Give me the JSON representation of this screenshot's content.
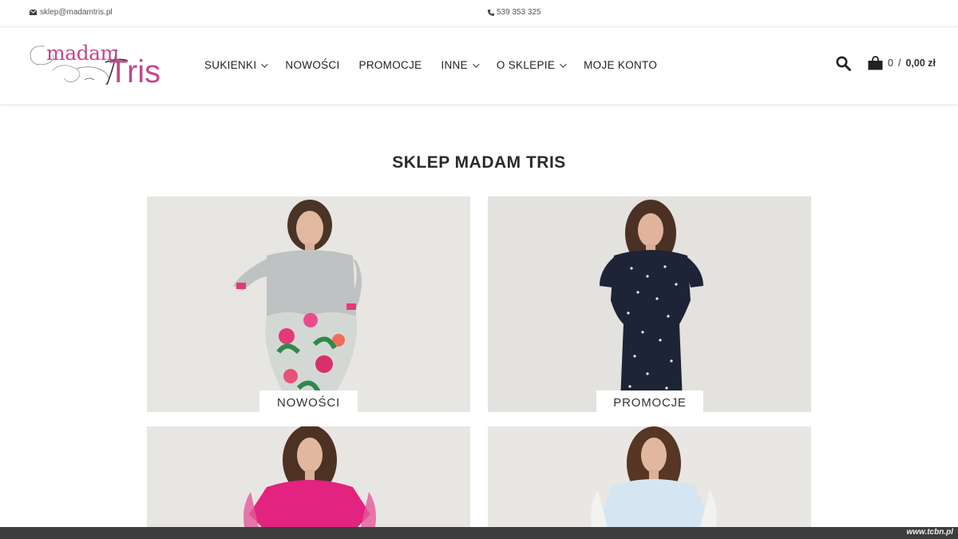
{
  "topbar": {
    "email": "sklep@madamtris.pl",
    "phone": "539 353 325"
  },
  "logo": {
    "word1": "madam",
    "word2": "Tris"
  },
  "nav": [
    {
      "label": "SUKIENKI",
      "dropdown": true
    },
    {
      "label": "NOWOŚCI",
      "dropdown": false
    },
    {
      "label": "PROMOCJE",
      "dropdown": false
    },
    {
      "label": "INNE",
      "dropdown": true
    },
    {
      "label": "O SKLEPIE",
      "dropdown": true
    },
    {
      "label": "MOJE KONTO",
      "dropdown": false
    }
  ],
  "cart": {
    "count": "0",
    "separator": "/",
    "total": "0,00 zł"
  },
  "main": {
    "title": "SKLEP MADAM TRIS",
    "tiles": [
      {
        "label": "NOWOŚCI",
        "dress": "grey-floral"
      },
      {
        "label": "PROMOCJE",
        "dress": "navy-dots"
      },
      {
        "label": "",
        "dress": "pink-top"
      },
      {
        "label": "",
        "dress": "light-blue-top"
      }
    ]
  },
  "watermark": "www.tcbn.pl",
  "colors": {
    "brand": "#c4488e",
    "text": "#222222",
    "footer": "#3d3d3d"
  }
}
